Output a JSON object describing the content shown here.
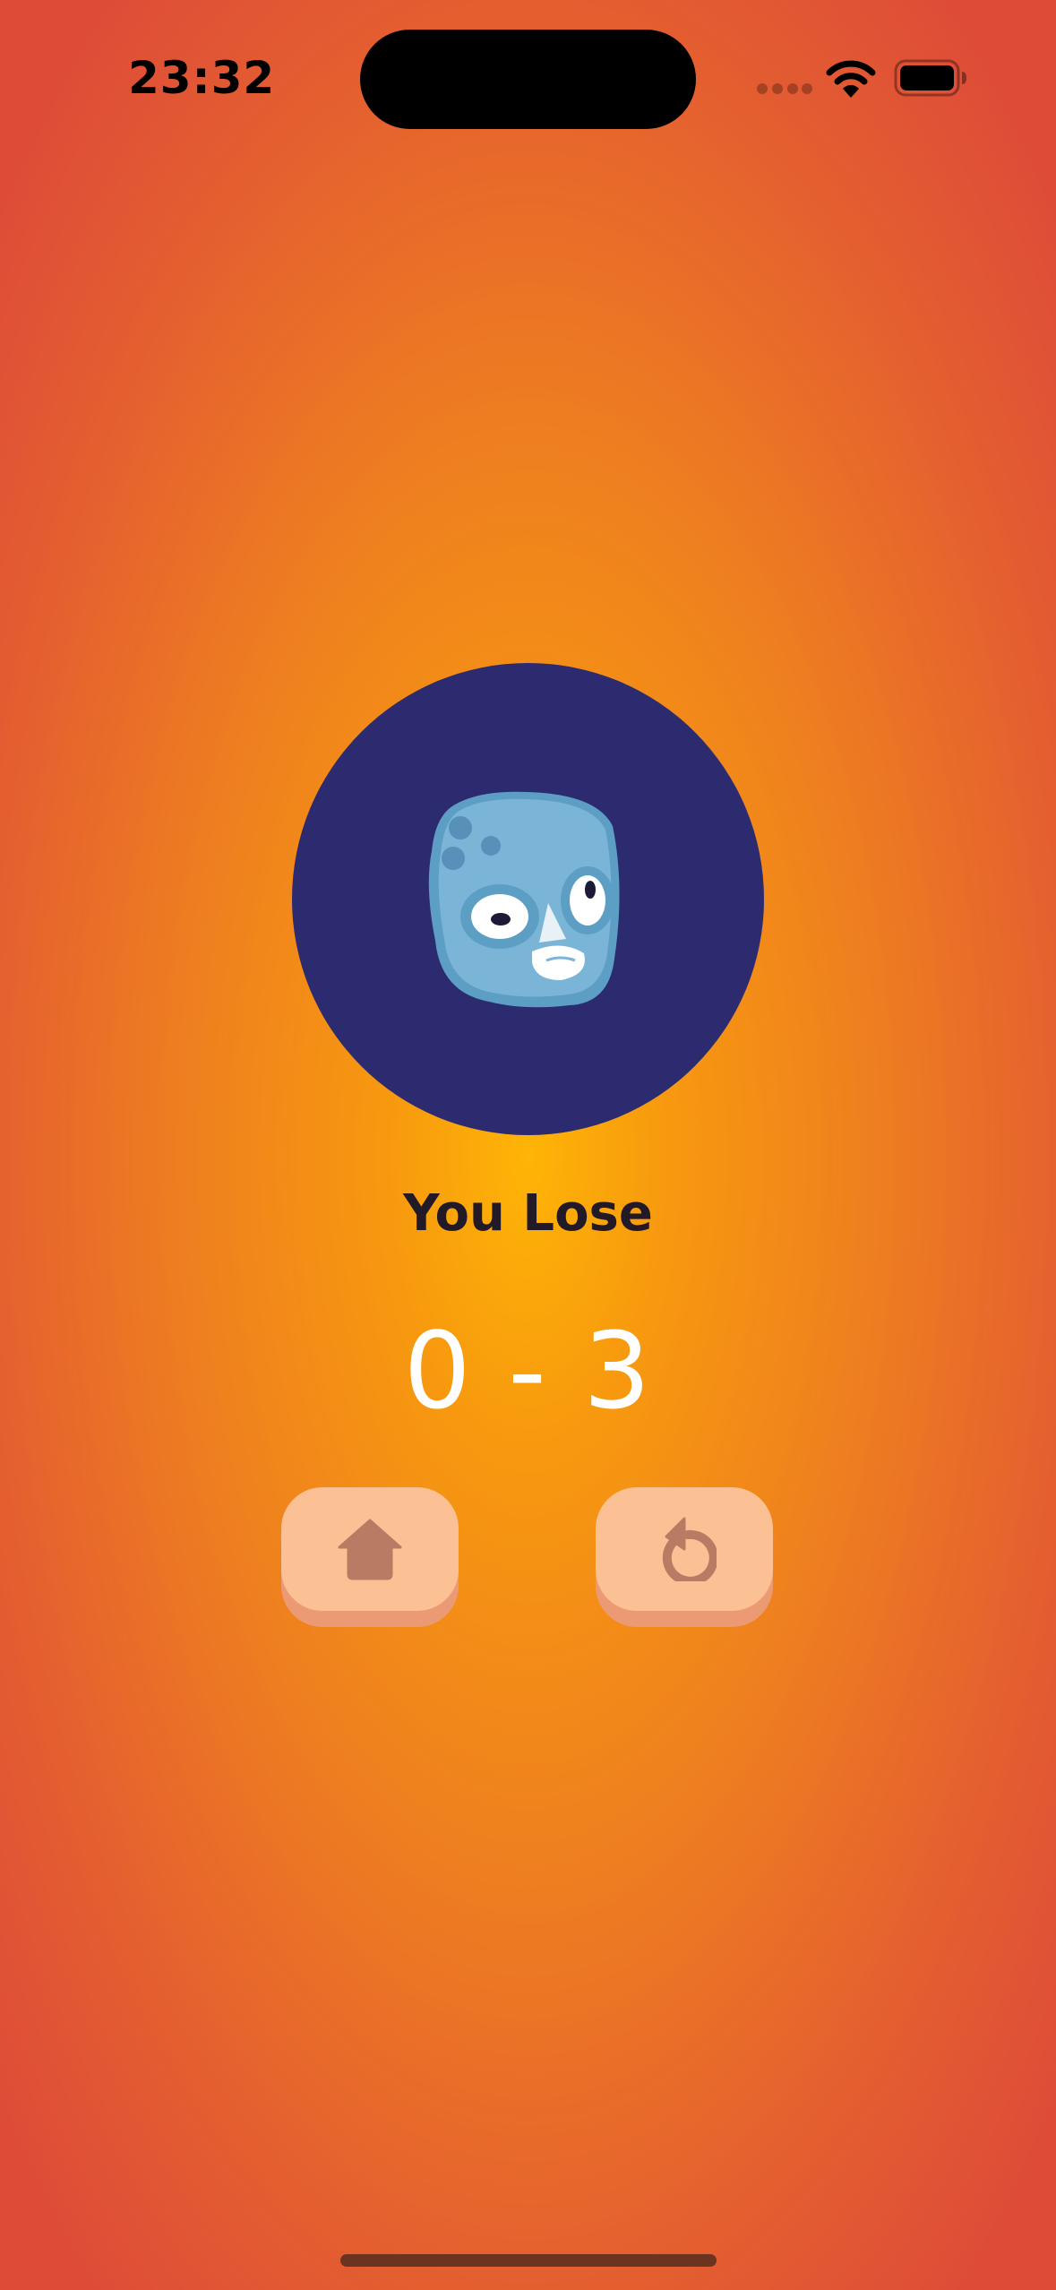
{
  "status_bar": {
    "time": "23:32"
  },
  "game_over": {
    "result_text": "You Lose",
    "score": "0 - 3",
    "avatar_icon": "blue-luchador-mask-icon"
  },
  "buttons": {
    "home_icon": "home-icon",
    "replay_icon": "replay-icon"
  },
  "colors": {
    "background_center": "#ffb406",
    "background_edge": "#de4c38",
    "avatar_circle": "#2d2b70",
    "button_face": "#fbc093",
    "button_shadow": "#ec9a73",
    "button_icon": "#b97b64",
    "title_text": "#221a27",
    "score_text": "#ffffff"
  }
}
